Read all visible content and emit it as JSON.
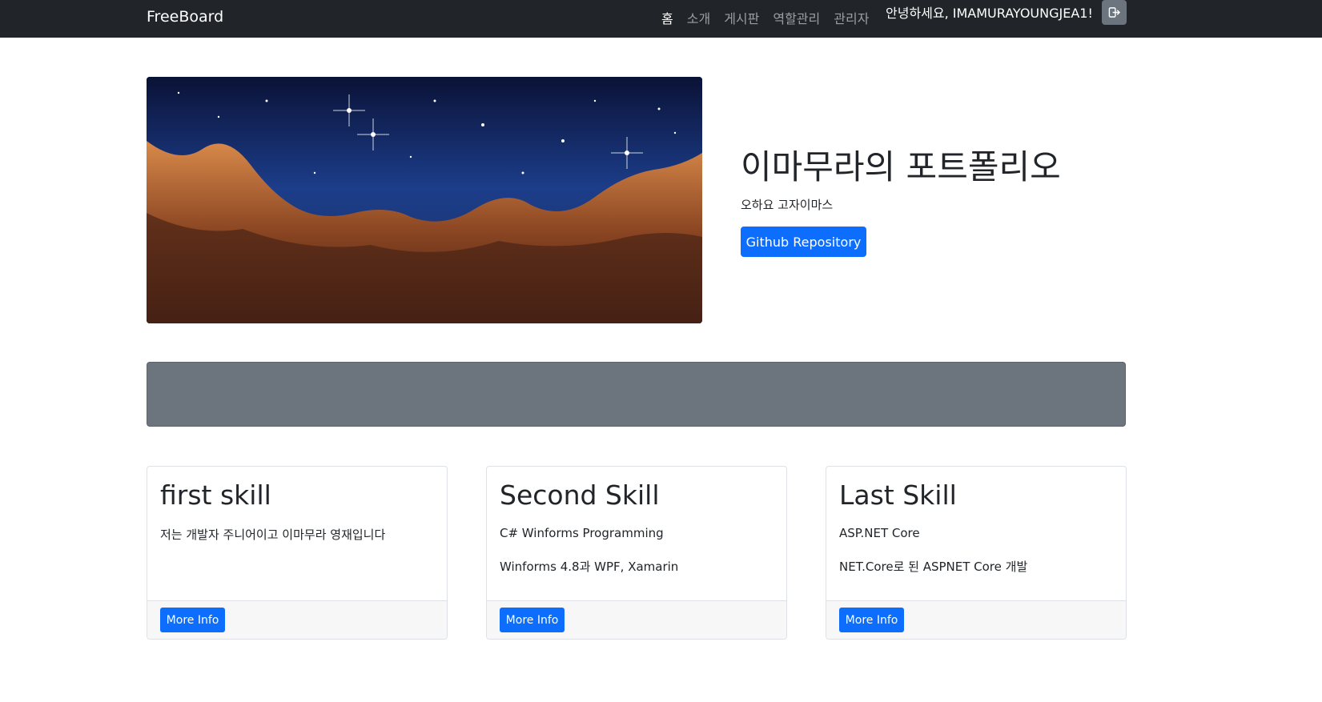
{
  "navbar": {
    "brand": "FreeBoard",
    "links": [
      "홈",
      "소개",
      "게시판",
      "역할관리",
      "관리자"
    ],
    "greeting": "안녕하세요, IMAMURAYOUNGJEA1!",
    "logout_icon": "logout-icon"
  },
  "hero": {
    "image": "nebula-image",
    "title": "이마무라의 포트폴리오",
    "subtitle": "오하요 고자이마스",
    "button": "Github Repository"
  },
  "cards": [
    {
      "title": "first skill",
      "text1": "저는 개발자 주니어이고 이마무라 영재입니다",
      "text2": "",
      "button": "More Info"
    },
    {
      "title": "Second Skill",
      "text1": "C# Winforms Programming",
      "text2": "Winforms 4.8과 WPF, Xamarin",
      "button": "More Info"
    },
    {
      "title": "Last Skill",
      "text1": "ASP.NET Core",
      "text2": "NET.Core로 된 ASPNET Core 개발",
      "button": "More Info"
    }
  ],
  "colors": {
    "navbar": "#212529",
    "primary": "#0d6efd",
    "banner": "#6c757d"
  }
}
